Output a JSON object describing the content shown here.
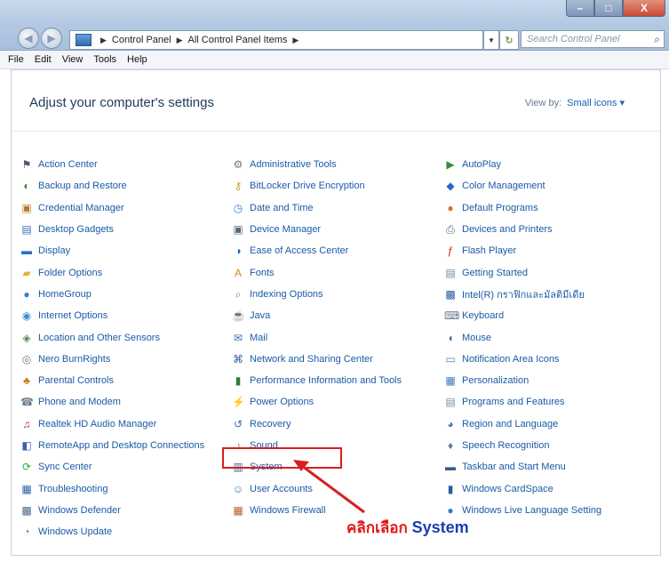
{
  "window": {
    "minimize": "–",
    "maximize": "□",
    "close": "X"
  },
  "address": {
    "crumbs": [
      "Control Panel",
      "All Control Panel Items"
    ]
  },
  "search": {
    "placeholder": "Search Control Panel"
  },
  "menu": [
    "File",
    "Edit",
    "View",
    "Tools",
    "Help"
  ],
  "main": {
    "heading": "Adjust your computer's settings",
    "view_by_label": "View by:",
    "view_by_value": "Small icons ▾"
  },
  "columns": [
    [
      {
        "label": "Action Center",
        "icon": "flag-icon",
        "color": "#4a5a6e",
        "glyph": "⚑"
      },
      {
        "label": "Backup and Restore",
        "icon": "backup-icon",
        "color": "#3d8a2e",
        "glyph": "◐"
      },
      {
        "label": "Credential Manager",
        "icon": "vault-icon",
        "color": "#b57a1f",
        "glyph": "▣"
      },
      {
        "label": "Desktop Gadgets",
        "icon": "gadgets-icon",
        "color": "#3b6fb8",
        "glyph": "▤"
      },
      {
        "label": "Display",
        "icon": "display-icon",
        "color": "#2b6cc4",
        "glyph": "▬"
      },
      {
        "label": "Folder Options",
        "icon": "folder-icon",
        "color": "#e2b23a",
        "glyph": "▰"
      },
      {
        "label": "HomeGroup",
        "icon": "homegroup-icon",
        "color": "#2e7fd0",
        "glyph": "●"
      },
      {
        "label": "Internet Options",
        "icon": "globe-icon",
        "color": "#3a8fd6",
        "glyph": "◉"
      },
      {
        "label": "Location and Other Sensors",
        "icon": "sensor-icon",
        "color": "#5a8a5a",
        "glyph": "◈"
      },
      {
        "label": "Nero BurnRights",
        "icon": "disc-icon",
        "color": "#777777",
        "glyph": "◎"
      },
      {
        "label": "Parental Controls",
        "icon": "parental-icon",
        "color": "#c47a1e",
        "glyph": "♣"
      },
      {
        "label": "Phone and Modem",
        "icon": "phone-icon",
        "color": "#6a7a8a",
        "glyph": "☎"
      },
      {
        "label": "Realtek HD Audio Manager",
        "icon": "audio-icon",
        "color": "#b83030",
        "glyph": "♫"
      },
      {
        "label": "RemoteApp and Desktop Connections",
        "icon": "remote-icon",
        "color": "#3a5fb0",
        "glyph": "◧"
      },
      {
        "label": "Sync Center",
        "icon": "sync-icon",
        "color": "#2ea83a",
        "glyph": "⟳"
      },
      {
        "label": "Troubleshooting",
        "icon": "troubleshoot-icon",
        "color": "#2b5fa8",
        "glyph": "▦"
      },
      {
        "label": "Windows Defender",
        "icon": "defender-icon",
        "color": "#4a6a8a",
        "glyph": "▩"
      },
      {
        "label": "Windows Update",
        "icon": "update-icon",
        "color": "#3a8ad0",
        "glyph": "◔"
      }
    ],
    [
      {
        "label": "Administrative Tools",
        "icon": "admin-tools-icon",
        "color": "#6a7a8a",
        "glyph": "⚙"
      },
      {
        "label": "BitLocker Drive Encryption",
        "icon": "bitlocker-icon",
        "color": "#c8a030",
        "glyph": "⚷"
      },
      {
        "label": "Date and Time",
        "icon": "clock-icon",
        "color": "#3a7ac0",
        "glyph": "◷"
      },
      {
        "label": "Device Manager",
        "icon": "device-manager-icon",
        "color": "#5a6a7a",
        "glyph": "▣"
      },
      {
        "label": "Ease of Access Center",
        "icon": "ease-access-icon",
        "color": "#1f5fb8",
        "glyph": "◑"
      },
      {
        "label": "Fonts",
        "icon": "fonts-icon",
        "color": "#d08a1a",
        "glyph": "A"
      },
      {
        "label": "Indexing Options",
        "icon": "indexing-icon",
        "color": "#7a8aa0",
        "glyph": "⌕"
      },
      {
        "label": "Java",
        "icon": "java-icon",
        "color": "#5a7ab0",
        "glyph": "☕"
      },
      {
        "label": "Mail",
        "icon": "mail-icon",
        "color": "#3a6fc0",
        "glyph": "✉"
      },
      {
        "label": "Network and Sharing Center",
        "icon": "network-icon",
        "color": "#2a5fa0",
        "glyph": "⌘"
      },
      {
        "label": "Performance Information and Tools",
        "icon": "performance-icon",
        "color": "#2e7a3a",
        "glyph": "▮"
      },
      {
        "label": "Power Options",
        "icon": "power-icon",
        "color": "#3aa03a",
        "glyph": "⚡"
      },
      {
        "label": "Recovery",
        "icon": "recovery-icon",
        "color": "#3a6ab0",
        "glyph": "↺"
      },
      {
        "label": "Sound",
        "icon": "sound-icon",
        "color": "#7a8a9a",
        "glyph": "♪"
      },
      {
        "label": "System",
        "icon": "system-icon",
        "color": "#4a6a9a",
        "glyph": "▥"
      },
      {
        "label": "User Accounts",
        "icon": "users-icon",
        "color": "#3a7ac0",
        "glyph": "☺"
      },
      {
        "label": "Windows Firewall",
        "icon": "firewall-icon",
        "color": "#b85a2a",
        "glyph": "▦"
      }
    ],
    [
      {
        "label": "AutoPlay",
        "icon": "autoplay-icon",
        "color": "#3a8a3a",
        "glyph": "▶"
      },
      {
        "label": "Color Management",
        "icon": "color-mgmt-icon",
        "color": "#2a6ac0",
        "glyph": "◆"
      },
      {
        "label": "Default Programs",
        "icon": "default-programs-icon",
        "color": "#e07020",
        "glyph": "●"
      },
      {
        "label": "Devices and Printers",
        "icon": "printer-icon",
        "color": "#5a6a7a",
        "glyph": "⎙"
      },
      {
        "label": "Flash Player",
        "icon": "flash-icon",
        "color": "#c81e1e",
        "glyph": "ƒ"
      },
      {
        "label": "Getting Started",
        "icon": "getting-started-icon",
        "color": "#6a8aa0",
        "glyph": "▤"
      },
      {
        "label": "Intel(R) กราฟิกและมัลติมีเดีย",
        "icon": "intel-graphics-icon",
        "color": "#2a5aa0",
        "glyph": "▩"
      },
      {
        "label": "Keyboard",
        "icon": "keyboard-icon",
        "color": "#6a7a8a",
        "glyph": "⌨"
      },
      {
        "label": "Mouse",
        "icon": "mouse-icon",
        "color": "#5a6a7a",
        "glyph": "◖"
      },
      {
        "label": "Notification Area Icons",
        "icon": "notification-icon",
        "color": "#5a7aa0",
        "glyph": "▭"
      },
      {
        "label": "Personalization",
        "icon": "personalization-icon",
        "color": "#3a7ac0",
        "glyph": "▦"
      },
      {
        "label": "Programs and Features",
        "icon": "programs-icon",
        "color": "#7a8aa0",
        "glyph": "▤"
      },
      {
        "label": "Region and Language",
        "icon": "region-icon",
        "color": "#3a7ac0",
        "glyph": "◕"
      },
      {
        "label": "Speech Recognition",
        "icon": "microphone-icon",
        "color": "#6a7a8a",
        "glyph": "♦"
      },
      {
        "label": "Taskbar and Start Menu",
        "icon": "taskbar-icon",
        "color": "#3a5a8a",
        "glyph": "▬"
      },
      {
        "label": "Windows CardSpace",
        "icon": "cardspace-icon",
        "color": "#2a5aa0",
        "glyph": "▮"
      },
      {
        "label": "Windows Live Language Setting",
        "icon": "language-icon",
        "color": "#2a7ad0",
        "glyph": "●"
      }
    ]
  ],
  "annotation": {
    "caption_thai": "คลิกเลือก",
    "caption_system": "System",
    "highlight_color": "#d61f1f"
  }
}
